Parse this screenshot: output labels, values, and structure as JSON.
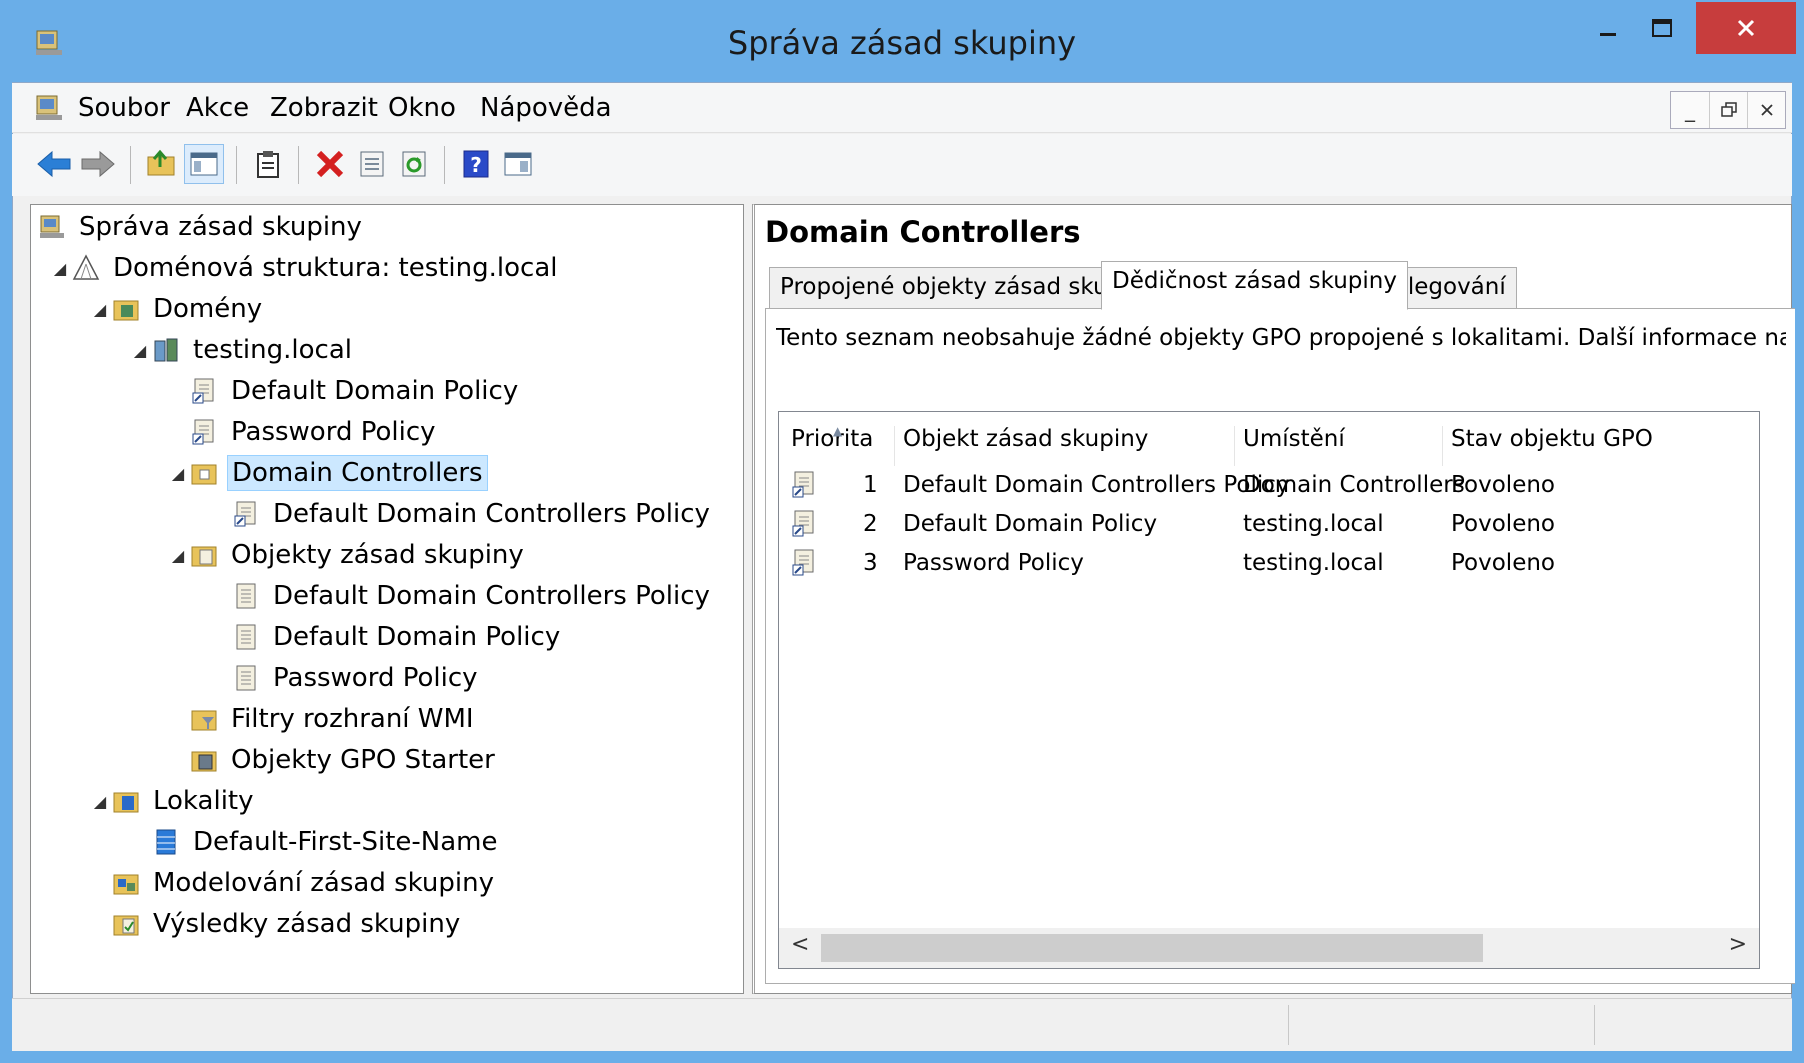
{
  "window": {
    "title": "Správa zásad skupiny"
  },
  "menu": {
    "items": [
      "Soubor",
      "Akce",
      "Zobrazit",
      "Okno",
      "Nápověda"
    ]
  },
  "tree": {
    "root": "Správa zásad skupiny",
    "forest": "Doménová struktura: testing.local",
    "domains": "Domény",
    "domain": "testing.local",
    "ddp": "Default Domain Policy",
    "pwp": "Password Policy",
    "dc": "Domain Controllers",
    "dcp": "Default Domain Controllers Policy",
    "gpo_folder": "Objekty zásad skupiny",
    "gpo_dcp": "Default Domain Controllers Policy",
    "gpo_ddp": "Default Domain Policy",
    "gpo_pwp": "Password Policy",
    "wmi": "Filtry rozhraní WMI",
    "starter": "Objekty GPO Starter",
    "sites": "Lokality",
    "site": "Default-First-Site-Name",
    "modeling": "Modelování zásad skupiny",
    "results": "Výsledky zásad skupiny"
  },
  "right": {
    "title": "Domain Controllers",
    "tabs": [
      "Propojené objekty zásad skupiny",
      "Dědičnost zásad skupiny",
      "Delegování"
    ],
    "active_tab": "Dědičnost zásad skupiny",
    "info": "Tento seznam neobsahuje žádné objekty GPO propojené s lokalitami. Další informace najd",
    "columns": [
      "Priorita",
      "Objekt zásad skupiny",
      "Umístění",
      "Stav objektu GPO"
    ],
    "rows": [
      {
        "priority": "1",
        "gpo": "Default Domain Controllers Policy",
        "location": "Domain Controllers",
        "status": "Povoleno"
      },
      {
        "priority": "2",
        "gpo": "Default Domain Policy",
        "location": "testing.local",
        "status": "Povoleno"
      },
      {
        "priority": "3",
        "gpo": "Password Policy",
        "location": "testing.local",
        "status": "Povoleno"
      }
    ]
  },
  "colors": {
    "frame": "#6aaee8",
    "close": "#c73d3d",
    "selection": "#cce8ff"
  }
}
